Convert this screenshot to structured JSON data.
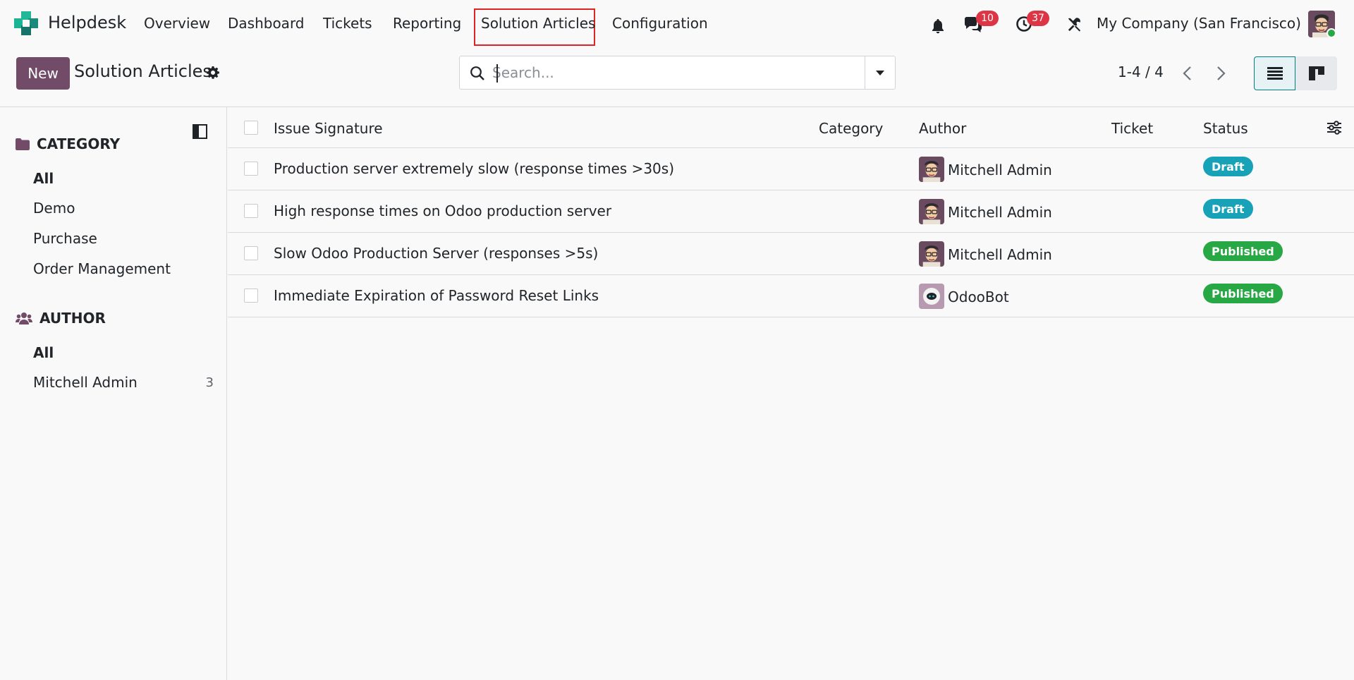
{
  "app": {
    "name": "Helpdesk"
  },
  "nav": {
    "items": [
      {
        "label": "Overview"
      },
      {
        "label": "Dashboard"
      },
      {
        "label": "Tickets"
      },
      {
        "label": "Reporting"
      },
      {
        "label": "Solution Articles",
        "active": true
      },
      {
        "label": "Configuration"
      }
    ]
  },
  "systray": {
    "messages_count": "10",
    "activities_count": "37",
    "company": "My Company (San Francisco)"
  },
  "control": {
    "new_label": "New",
    "title": "Solution Articles",
    "search_placeholder": "Search...",
    "pager": "1-4 / 4"
  },
  "sidebar": {
    "category_heading": "CATEGORY",
    "category_items": [
      "All",
      "Demo",
      "Purchase",
      "Order Management"
    ],
    "author_heading": "AUTHOR",
    "author_items": [
      {
        "label": "All",
        "count": ""
      },
      {
        "label": "Mitchell Admin",
        "count": "3"
      }
    ]
  },
  "table": {
    "columns": [
      "Issue Signature",
      "Category",
      "Author",
      "Ticket",
      "Status"
    ],
    "rows": [
      {
        "title": "Production server extremely slow (response times >30s)",
        "author": "Mitchell Admin",
        "author_icon": "admin-avatar",
        "status": "Draft",
        "status_color": "#17a2b8"
      },
      {
        "title": "High response times on Odoo production server",
        "author": "Mitchell Admin",
        "author_icon": "admin-avatar",
        "status": "Draft",
        "status_color": "#17a2b8"
      },
      {
        "title": "Slow Odoo Production Server (responses >5s)",
        "author": "Mitchell Admin",
        "author_icon": "admin-avatar",
        "status": "Published",
        "status_color": "#28a745"
      },
      {
        "title": "Immediate Expiration of Password Reset Links",
        "author": "OdooBot",
        "author_icon": "odoobot-avatar",
        "status": "Published",
        "status_color": "#28a745"
      }
    ]
  },
  "colors": {
    "brand": "#714b67",
    "accent": "#017e84",
    "badge_red": "#dc3545",
    "highlight_box": "#e02424"
  }
}
